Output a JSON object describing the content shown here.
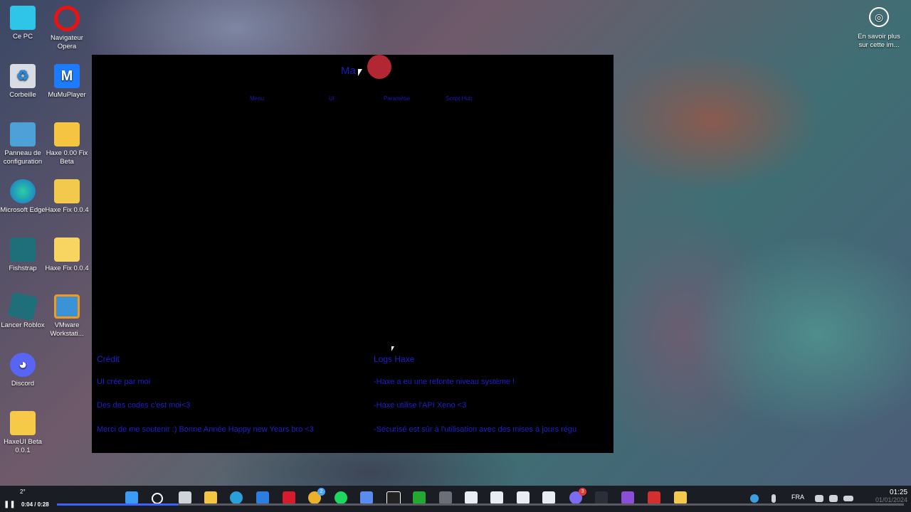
{
  "desktop": {
    "icons": [
      {
        "label": "Ce PC"
      },
      {
        "label": "Navigateur Opera"
      },
      {
        "label": "Corbeille"
      },
      {
        "label": "MuMuPlayer"
      },
      {
        "label": "Panneau de configuration"
      },
      {
        "label": "Haxe 0.00 Fix Beta"
      },
      {
        "label": "Microsoft Edge"
      },
      {
        "label": "Haxe Fix 0.0.4"
      },
      {
        "label": "Fishstrap"
      },
      {
        "label": "Haxe Fix 0.0.4"
      },
      {
        "label": "Lancer Roblox"
      },
      {
        "label": "VMware Workstati..."
      },
      {
        "label": "Discord"
      },
      {
        "label": "HaxeUI Beta 0.0.1"
      }
    ],
    "info_widget": {
      "label": "En savoir plus sur cette im..."
    }
  },
  "app": {
    "title": "Ma",
    "tabs": [
      "Menu",
      "UI",
      "Paramètre",
      "Script Hub"
    ],
    "left_column": {
      "heading": "Crédit",
      "lines": [
        "UI crée par moi",
        "Des des codes c'est moi<3",
        "Merci de me soutenir :) Bonne Année Happy new Years bro <3"
      ]
    },
    "right_column": {
      "heading": "Logs Haxe",
      "lines": [
        "-Haxe a eu une refonte niveau système !",
        "-Haxe utilise l'API Xeno <3",
        "-Sécurisé est sûr à l'utilisation avec des mises à jours régu"
      ]
    }
  },
  "taskbar": {
    "weather": "2°",
    "language": "FRA",
    "time": "01:25",
    "date": "01/01/2024",
    "badges": {
      "chat": "2",
      "mail": "3"
    }
  },
  "video": {
    "time": "0:04 / 0:28",
    "progress": 0.143
  }
}
